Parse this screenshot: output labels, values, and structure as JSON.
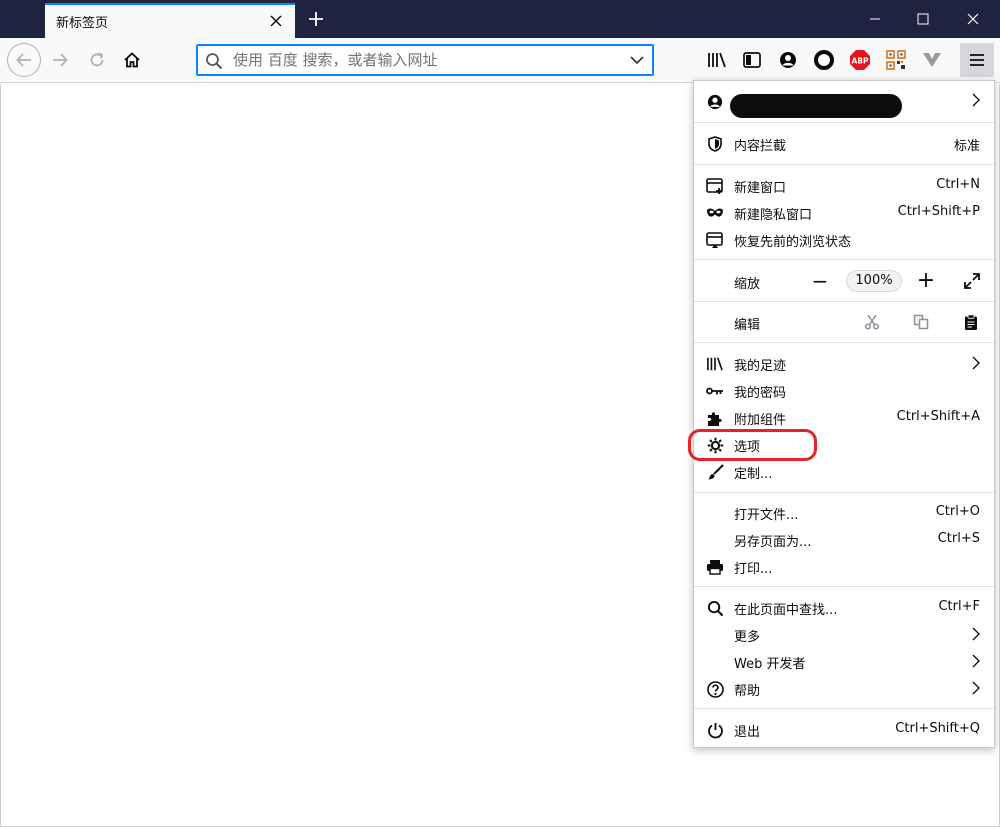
{
  "tabbar": {
    "tab_title": "新标签页",
    "icons": [
      "close-icon",
      "plus-icon",
      "minimize-icon",
      "maximize-icon",
      "window-close-icon"
    ]
  },
  "navbar": {
    "url_placeholder": "使用 百度 搜索，或者输入网址",
    "icons": [
      "back-arrow-icon",
      "forward-arrow-icon",
      "reload-icon",
      "home-icon",
      "search-icon",
      "chevron-down-icon",
      "library-icon",
      "sidebar-icon",
      "account-icon",
      "extension-circle-icon",
      "abp-icon",
      "qr-code-icon",
      "vpn-v-icon",
      "hamburger-menu-icon"
    ],
    "abp_label": "ABP"
  },
  "menu": {
    "account_chevron": "›",
    "content_blocking": {
      "label": "内容拦截",
      "value": "标准"
    },
    "new_window": {
      "label": "新建窗口",
      "shortcut": "Ctrl+N"
    },
    "private_window": {
      "label": "新建隐私窗口",
      "shortcut": "Ctrl+Shift+P"
    },
    "restore_session": {
      "label": "恢复先前的浏览状态"
    },
    "zoom": {
      "label": "缩放",
      "minus": "−",
      "value": "100%",
      "plus": "+"
    },
    "edit": {
      "label": "编辑"
    },
    "library": {
      "label": "我的足迹"
    },
    "passwords": {
      "label": "我的密码"
    },
    "addons": {
      "label": "附加组件",
      "shortcut": "Ctrl+Shift+A"
    },
    "options": {
      "label": "选项"
    },
    "customize": {
      "label": "定制..."
    },
    "open_file": {
      "label": "打开文件...",
      "shortcut": "Ctrl+O"
    },
    "save_page": {
      "label": "另存页面为...",
      "shortcut": "Ctrl+S"
    },
    "print": {
      "label": "打印..."
    },
    "find": {
      "label": "在此页面中查找...",
      "shortcut": "Ctrl+F"
    },
    "more": {
      "label": "更多"
    },
    "web_developer": {
      "label": "Web 开发者"
    },
    "help": {
      "label": "帮助"
    },
    "quit": {
      "label": "退出",
      "shortcut": "Ctrl+Shift+Q"
    }
  },
  "colors": {
    "tabbar_bg": "#202340",
    "accent": "#0a84ff",
    "highlight": "#e32229",
    "abp_red": "#e4151c"
  }
}
